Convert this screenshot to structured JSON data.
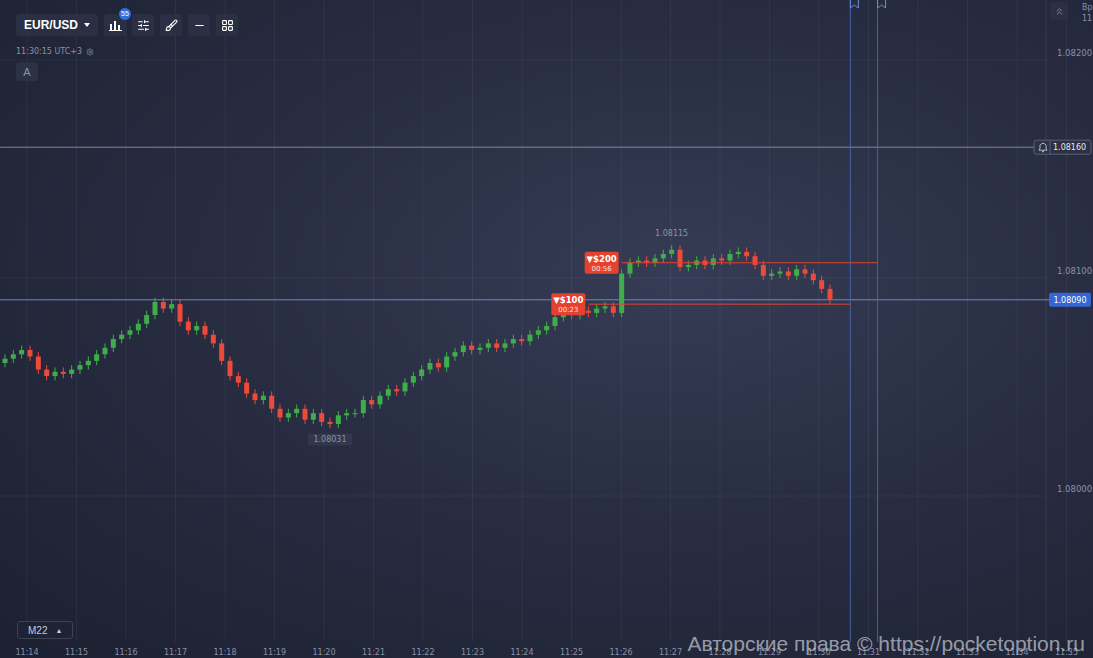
{
  "toolbar": {
    "symbol": "EUR/USD",
    "indicators_badge": "55",
    "clock": "11:30:15 UTC+3",
    "drawing_mode": "A"
  },
  "chart": {
    "price_ticks": [
      "1.08200",
      "1.08100",
      "1.08000"
    ],
    "time_ticks": [
      "11:14",
      "11:15",
      "11:16",
      "11:17",
      "11:18",
      "11:19",
      "11:20",
      "11:21",
      "11:22",
      "11:23",
      "11:24",
      "11:25",
      "11:26",
      "11:27",
      "11:28",
      "11:29",
      "11:30",
      "11:31",
      "11:32",
      "11:33",
      "11:34",
      "11:35"
    ],
    "open": 1.08061,
    "closes": [
      1.08063,
      1.08065,
      1.08067,
      1.08064,
      1.08058,
      1.08055,
      1.08057,
      1.08056,
      1.08058,
      1.0806,
      1.08062,
      1.08065,
      1.08068,
      1.08072,
      1.08074,
      1.08076,
      1.08079,
      1.08083,
      1.08089,
      1.08086,
      1.08088,
      1.0808,
      1.08076,
      1.08078,
      1.08074,
      1.0807,
      1.08062,
      1.08055,
      1.08052,
      1.08047,
      1.08044,
      1.08046,
      1.0804,
      1.08036,
      1.08038,
      1.0804,
      1.08035,
      1.08038,
      1.08034,
      1.08033,
      1.08037,
      1.08038,
      1.08038,
      1.08044,
      1.08042,
      1.08046,
      1.08049,
      1.08048,
      1.08052,
      1.08055,
      1.08058,
      1.08061,
      1.08059,
      1.08064,
      1.08066,
      1.08069,
      1.08067,
      1.08068,
      1.0807,
      1.08068,
      1.0807,
      1.08072,
      1.08071,
      1.08074,
      1.08076,
      1.08078,
      1.08082,
      1.08084,
      1.08083,
      1.08085,
      1.08084,
      1.08086,
      1.08087,
      1.08084,
      1.08102,
      1.08107,
      1.08108,
      1.08107,
      1.08109,
      1.08111,
      1.08113,
      1.08105,
      1.08106,
      1.08108,
      1.08106,
      1.08109,
      1.08108,
      1.08111,
      1.08112,
      1.0811,
      1.08106,
      1.08101,
      1.08102,
      1.08103,
      1.08101,
      1.08104,
      1.08102,
      1.08099,
      1.08095,
      1.0809
    ],
    "high_label": "1.08115",
    "low_label": "1.08031",
    "current_price": "1.08090",
    "alert_price": "1.08160",
    "trades": [
      {
        "direction": "▼",
        "amount": "$200",
        "timer": "00:56",
        "entry": 1.08107,
        "candle": 74
      },
      {
        "direction": "▼",
        "amount": "$100",
        "timer": "00:23",
        "entry": 1.08088,
        "candle": 70
      }
    ]
  },
  "timeframe": {
    "label": "M22",
    "arrow": "▲"
  },
  "watermark": "Авторские права © https://pocketoption.ru",
  "corner": {
    "label": "Вр",
    "time": "11"
  }
}
